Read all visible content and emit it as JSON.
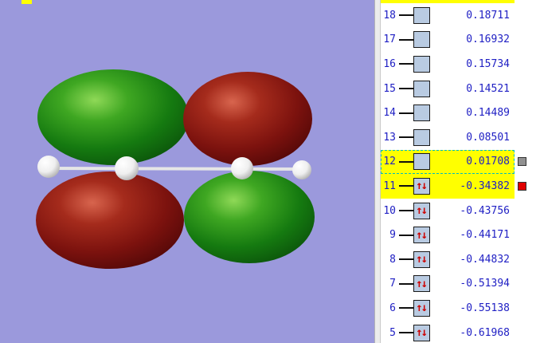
{
  "viewport": {
    "content": "molecular-orbital-isosurface",
    "atoms": "four-hydrogen-like-white-spheres",
    "lobes": [
      "green-top-left",
      "red-bottom-left",
      "red-top-right",
      "green-bottom-right"
    ]
  },
  "colors": {
    "viewport_bg": "#9b99dc",
    "lobe_green": "#1b8a12",
    "lobe_red": "#8a1510",
    "atom_white": "#f2f2f2",
    "row_highlight": "#ffff00",
    "selection_dash": "#00bcbc",
    "level_box_fill": "#b9cbe2",
    "list_text": "#2020c4",
    "swatch_virtual": "#919191",
    "swatch_occupied": "#e00000",
    "arrow_red": "#cc0000"
  },
  "orbital_list": {
    "occupied_arrows": "↑↓",
    "rows": [
      {
        "index": "18",
        "value": "0.18711",
        "occupied": false,
        "highlighted": false,
        "selected": false,
        "swatch": null
      },
      {
        "index": "17",
        "value": "0.16932",
        "occupied": false,
        "highlighted": false,
        "selected": false,
        "swatch": null
      },
      {
        "index": "16",
        "value": "0.15734",
        "occupied": false,
        "highlighted": false,
        "selected": false,
        "swatch": null
      },
      {
        "index": "15",
        "value": "0.14521",
        "occupied": false,
        "highlighted": false,
        "selected": false,
        "swatch": null
      },
      {
        "index": "14",
        "value": "0.14489",
        "occupied": false,
        "highlighted": false,
        "selected": false,
        "swatch": null
      },
      {
        "index": "13",
        "value": "0.08501",
        "occupied": false,
        "highlighted": false,
        "selected": false,
        "swatch": null
      },
      {
        "index": "12",
        "value": "0.01708",
        "occupied": false,
        "highlighted": true,
        "selected": true,
        "swatch": "#919191"
      },
      {
        "index": "11",
        "value": "-0.34382",
        "occupied": true,
        "highlighted": true,
        "selected": false,
        "swatch": "#e00000"
      },
      {
        "index": "10",
        "value": "-0.43756",
        "occupied": true,
        "highlighted": false,
        "selected": false,
        "swatch": null
      },
      {
        "index": "9",
        "value": "-0.44171",
        "occupied": true,
        "highlighted": false,
        "selected": false,
        "swatch": null
      },
      {
        "index": "8",
        "value": "-0.44832",
        "occupied": true,
        "highlighted": false,
        "selected": false,
        "swatch": null
      },
      {
        "index": "7",
        "value": "-0.51394",
        "occupied": true,
        "highlighted": false,
        "selected": false,
        "swatch": null
      },
      {
        "index": "6",
        "value": "-0.55138",
        "occupied": true,
        "highlighted": false,
        "selected": false,
        "swatch": null
      },
      {
        "index": "5",
        "value": "-0.61968",
        "occupied": true,
        "highlighted": false,
        "selected": false,
        "swatch": null
      }
    ]
  }
}
